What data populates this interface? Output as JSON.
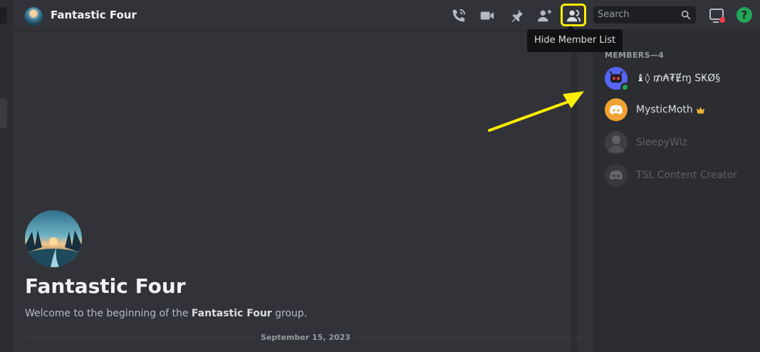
{
  "header": {
    "title": "Fantastic Four",
    "search_placeholder": "Search",
    "icons": [
      "voice-call-icon",
      "video-call-icon",
      "pinned-messages-icon",
      "add-friend-icon",
      "member-list-icon",
      "search-icon",
      "inbox-icon",
      "help-icon"
    ],
    "help_glyph": "?"
  },
  "tooltip": {
    "text": "Hide Member List"
  },
  "welcome": {
    "title": "Fantastic Four",
    "subtitle_prefix": "Welcome to the beginning of the ",
    "subtitle_group": "Fantastic Four",
    "subtitle_suffix": " group.",
    "date": "September 15, 2023"
  },
  "members": {
    "header": "MEMBERS—4",
    "items": [
      {
        "name": "♝◊ ₥₳₮Ɇɱ S₭Ø§",
        "status": "online",
        "avatar_color": "#5865f2",
        "avatar_icon": "robot-avatar-icon"
      },
      {
        "name": "MysticMoth",
        "status": "online",
        "owner": true,
        "avatar_color": "#f0a232",
        "avatar_icon": "discord-logo-icon"
      },
      {
        "name": "SleepyWiz",
        "status": "offline",
        "avatar_color": "#4a4d52",
        "avatar_icon": "photo-avatar-icon"
      },
      {
        "name": "TSL Content Creator",
        "status": "offline",
        "avatar_color": "#3f4147",
        "avatar_icon": "discord-logo-icon"
      }
    ]
  },
  "colors": {
    "highlight": "#ffee00",
    "online": "#23a55a",
    "owner_crown": "#f0b232",
    "background": "#313338",
    "sidebar": "#2b2d31"
  }
}
